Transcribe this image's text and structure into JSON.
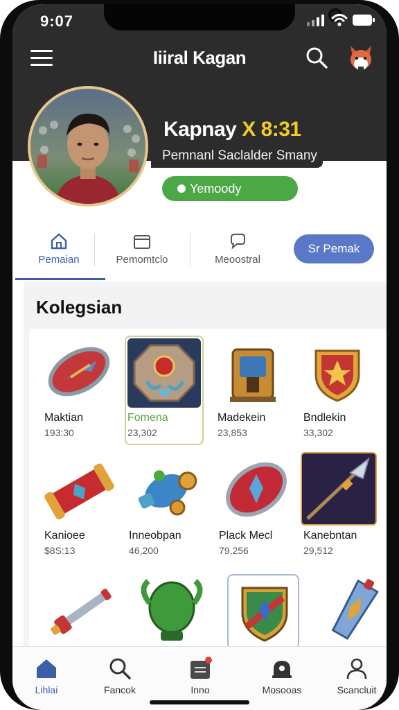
{
  "status_bar": {
    "time": "9:07"
  },
  "header": {
    "title": "Iiiral Kagan"
  },
  "profile": {
    "name_main": "Kapnay",
    "name_accent": "X 8:31",
    "subtitle": "Pemnanl Saclalder Smany",
    "status": "Yemoody"
  },
  "tabs": [
    {
      "label": "Pemaian",
      "icon": "home-icon"
    },
    {
      "label": "Pemomtclo",
      "icon": "folder-icon"
    },
    {
      "label": "Meoostral",
      "icon": "chat-icon"
    }
  ],
  "tab_button": {
    "label": "Sr Pemak"
  },
  "collection": {
    "title": "Kolegsian",
    "items": [
      {
        "name": "Maktian",
        "price": "193:30",
        "icon": "shield-icon"
      },
      {
        "name": "Fomena",
        "price": "23,302",
        "icon": "gem-octagon-icon"
      },
      {
        "name": "Madekein",
        "price": "23,853",
        "icon": "chest-icon"
      },
      {
        "name": "Bndlekin",
        "price": "33,302",
        "icon": "crest-shield-icon"
      },
      {
        "name": "Kanioee",
        "price": "$8S:13",
        "icon": "scroll-icon"
      },
      {
        "name": "Inneobpan",
        "price": "46,200",
        "icon": "cannon-icon"
      },
      {
        "name": "Plack Mecl",
        "price": "79,256",
        "icon": "red-shield-icon"
      },
      {
        "name": "Kanebntan",
        "price": "29,512",
        "icon": "spear-icon"
      },
      {
        "name": "",
        "price": "",
        "icon": "sword-icon"
      },
      {
        "name": "",
        "price": "",
        "icon": "green-helmet-icon"
      },
      {
        "name": "",
        "price": "",
        "icon": "emblem-shield-icon"
      },
      {
        "name": "",
        "price": "",
        "icon": "crystal-blade-icon"
      }
    ]
  },
  "bottom_nav": [
    {
      "label": "Lihlai",
      "icon": "home-icon"
    },
    {
      "label": "Fancok",
      "icon": "search-icon"
    },
    {
      "label": "Inno",
      "icon": "inbox-icon"
    },
    {
      "label": "Mosooas",
      "icon": "bell-icon"
    },
    {
      "label": "Scancluit",
      "icon": "profile-icon"
    }
  ],
  "colors": {
    "header_bg": "#2c2c2c",
    "accent": "#f4cd24",
    "status_green": "#4ca845",
    "primary_blue": "#5a78c8",
    "active_tab": "#3d5fa8"
  }
}
